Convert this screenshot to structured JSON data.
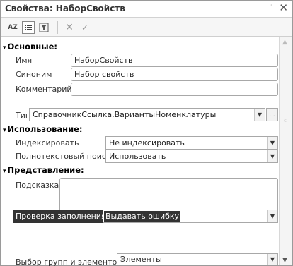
{
  "window": {
    "title": "Свойства: НаборСвойств"
  },
  "groups": {
    "main": "Основные:",
    "usage": "Использование:",
    "presentation": "Представление:"
  },
  "fields": {
    "name": {
      "label": "Имя",
      "value": "НаборСвойств"
    },
    "synonym": {
      "label": "Синоним",
      "value": "Набор свойств"
    },
    "comment": {
      "label": "Комментарий",
      "value": ""
    },
    "type": {
      "label": "Тип",
      "value": "СправочникСсылка.ВариантыНоменклатуры"
    },
    "indexing": {
      "label": "Индексировать",
      "value": "Не индексировать"
    },
    "fulltext": {
      "label": "Полнотекстовый поиск",
      "value": "Использовать"
    },
    "tooltip": {
      "label": "Подсказка",
      "value": ""
    },
    "fill_check": {
      "label": "Проверка заполнения",
      "value": "Выдавать ошибку"
    },
    "group_select": {
      "label": "Выбор групп и элементов",
      "value": "Элементы"
    }
  },
  "glyphs": {
    "close": "✕",
    "pin": "ᵖ",
    "sort": "AZ",
    "cancel": "✕",
    "accept": "✓",
    "dropdown": "▼",
    "ellipsis": "...",
    "expanded": "▾",
    "scroll_up": "▲",
    "scroll_down": "▼"
  }
}
